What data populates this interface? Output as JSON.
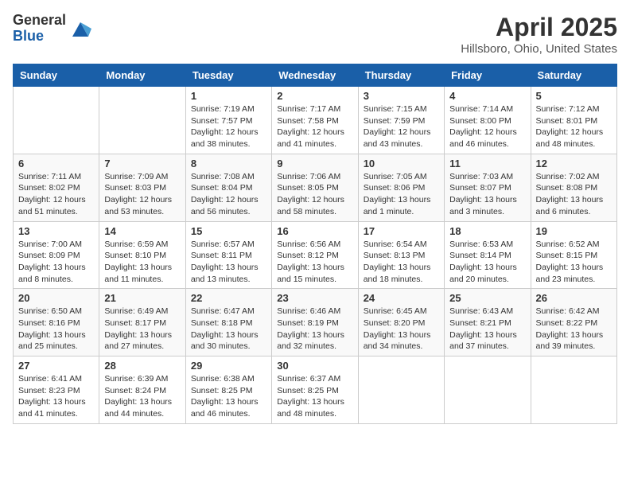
{
  "header": {
    "logo": {
      "general": "General",
      "blue": "Blue"
    },
    "title": "April 2025",
    "subtitle": "Hillsboro, Ohio, United States"
  },
  "calendar": {
    "weekdays": [
      "Sunday",
      "Monday",
      "Tuesday",
      "Wednesday",
      "Thursday",
      "Friday",
      "Saturday"
    ],
    "weeks": [
      [
        {
          "day": "",
          "info": ""
        },
        {
          "day": "",
          "info": ""
        },
        {
          "day": "1",
          "info": "Sunrise: 7:19 AM\nSunset: 7:57 PM\nDaylight: 12 hours and 38 minutes."
        },
        {
          "day": "2",
          "info": "Sunrise: 7:17 AM\nSunset: 7:58 PM\nDaylight: 12 hours and 41 minutes."
        },
        {
          "day": "3",
          "info": "Sunrise: 7:15 AM\nSunset: 7:59 PM\nDaylight: 12 hours and 43 minutes."
        },
        {
          "day": "4",
          "info": "Sunrise: 7:14 AM\nSunset: 8:00 PM\nDaylight: 12 hours and 46 minutes."
        },
        {
          "day": "5",
          "info": "Sunrise: 7:12 AM\nSunset: 8:01 PM\nDaylight: 12 hours and 48 minutes."
        }
      ],
      [
        {
          "day": "6",
          "info": "Sunrise: 7:11 AM\nSunset: 8:02 PM\nDaylight: 12 hours and 51 minutes."
        },
        {
          "day": "7",
          "info": "Sunrise: 7:09 AM\nSunset: 8:03 PM\nDaylight: 12 hours and 53 minutes."
        },
        {
          "day": "8",
          "info": "Sunrise: 7:08 AM\nSunset: 8:04 PM\nDaylight: 12 hours and 56 minutes."
        },
        {
          "day": "9",
          "info": "Sunrise: 7:06 AM\nSunset: 8:05 PM\nDaylight: 12 hours and 58 minutes."
        },
        {
          "day": "10",
          "info": "Sunrise: 7:05 AM\nSunset: 8:06 PM\nDaylight: 13 hours and 1 minute."
        },
        {
          "day": "11",
          "info": "Sunrise: 7:03 AM\nSunset: 8:07 PM\nDaylight: 13 hours and 3 minutes."
        },
        {
          "day": "12",
          "info": "Sunrise: 7:02 AM\nSunset: 8:08 PM\nDaylight: 13 hours and 6 minutes."
        }
      ],
      [
        {
          "day": "13",
          "info": "Sunrise: 7:00 AM\nSunset: 8:09 PM\nDaylight: 13 hours and 8 minutes."
        },
        {
          "day": "14",
          "info": "Sunrise: 6:59 AM\nSunset: 8:10 PM\nDaylight: 13 hours and 11 minutes."
        },
        {
          "day": "15",
          "info": "Sunrise: 6:57 AM\nSunset: 8:11 PM\nDaylight: 13 hours and 13 minutes."
        },
        {
          "day": "16",
          "info": "Sunrise: 6:56 AM\nSunset: 8:12 PM\nDaylight: 13 hours and 15 minutes."
        },
        {
          "day": "17",
          "info": "Sunrise: 6:54 AM\nSunset: 8:13 PM\nDaylight: 13 hours and 18 minutes."
        },
        {
          "day": "18",
          "info": "Sunrise: 6:53 AM\nSunset: 8:14 PM\nDaylight: 13 hours and 20 minutes."
        },
        {
          "day": "19",
          "info": "Sunrise: 6:52 AM\nSunset: 8:15 PM\nDaylight: 13 hours and 23 minutes."
        }
      ],
      [
        {
          "day": "20",
          "info": "Sunrise: 6:50 AM\nSunset: 8:16 PM\nDaylight: 13 hours and 25 minutes."
        },
        {
          "day": "21",
          "info": "Sunrise: 6:49 AM\nSunset: 8:17 PM\nDaylight: 13 hours and 27 minutes."
        },
        {
          "day": "22",
          "info": "Sunrise: 6:47 AM\nSunset: 8:18 PM\nDaylight: 13 hours and 30 minutes."
        },
        {
          "day": "23",
          "info": "Sunrise: 6:46 AM\nSunset: 8:19 PM\nDaylight: 13 hours and 32 minutes."
        },
        {
          "day": "24",
          "info": "Sunrise: 6:45 AM\nSunset: 8:20 PM\nDaylight: 13 hours and 34 minutes."
        },
        {
          "day": "25",
          "info": "Sunrise: 6:43 AM\nSunset: 8:21 PM\nDaylight: 13 hours and 37 minutes."
        },
        {
          "day": "26",
          "info": "Sunrise: 6:42 AM\nSunset: 8:22 PM\nDaylight: 13 hours and 39 minutes."
        }
      ],
      [
        {
          "day": "27",
          "info": "Sunrise: 6:41 AM\nSunset: 8:23 PM\nDaylight: 13 hours and 41 minutes."
        },
        {
          "day": "28",
          "info": "Sunrise: 6:39 AM\nSunset: 8:24 PM\nDaylight: 13 hours and 44 minutes."
        },
        {
          "day": "29",
          "info": "Sunrise: 6:38 AM\nSunset: 8:25 PM\nDaylight: 13 hours and 46 minutes."
        },
        {
          "day": "30",
          "info": "Sunrise: 6:37 AM\nSunset: 8:25 PM\nDaylight: 13 hours and 48 minutes."
        },
        {
          "day": "",
          "info": ""
        },
        {
          "day": "",
          "info": ""
        },
        {
          "day": "",
          "info": ""
        }
      ]
    ]
  }
}
